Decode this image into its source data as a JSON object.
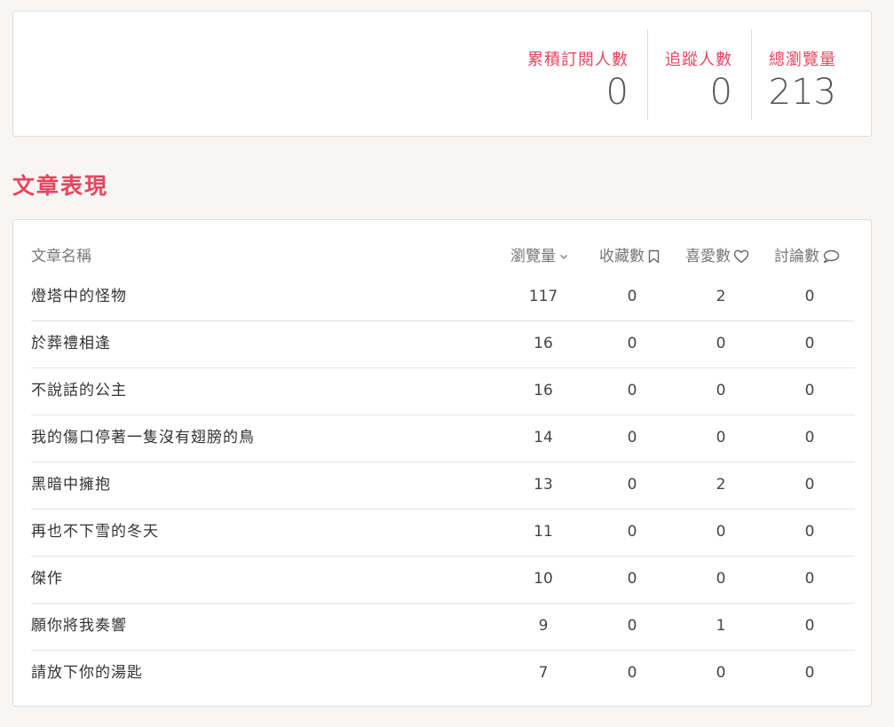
{
  "stats": {
    "subscribers": {
      "label": "累積訂閱人數",
      "value": "0"
    },
    "followers": {
      "label": "追蹤人數",
      "value": "0"
    },
    "total_views": {
      "label": "總瀏覽量",
      "value": "213"
    }
  },
  "section_title": "文章表現",
  "table": {
    "headers": {
      "name": "文章名稱",
      "views": "瀏覽量",
      "saves": "收藏數",
      "likes": "喜愛數",
      "comments": "討論數"
    },
    "icons": {
      "views": "chevron-down-icon",
      "saves": "bookmark-icon",
      "likes": "heart-icon",
      "comments": "comment-icon"
    },
    "rows": [
      {
        "name": "燈塔中的怪物",
        "views": "117",
        "saves": "0",
        "likes": "2",
        "comments": "0"
      },
      {
        "name": "於葬禮相逢",
        "views": "16",
        "saves": "0",
        "likes": "0",
        "comments": "0"
      },
      {
        "name": "不說話的公主",
        "views": "16",
        "saves": "0",
        "likes": "0",
        "comments": "0"
      },
      {
        "name": "我的傷口停著一隻沒有翅膀的鳥",
        "views": "14",
        "saves": "0",
        "likes": "0",
        "comments": "0"
      },
      {
        "name": "黑暗中擁抱",
        "views": "13",
        "saves": "0",
        "likes": "2",
        "comments": "0"
      },
      {
        "name": "再也不下雪的冬天",
        "views": "11",
        "saves": "0",
        "likes": "0",
        "comments": "0"
      },
      {
        "name": "傑作",
        "views": "10",
        "saves": "0",
        "likes": "0",
        "comments": "0"
      },
      {
        "name": "願你將我奏響",
        "views": "9",
        "saves": "0",
        "likes": "1",
        "comments": "0"
      },
      {
        "name": "請放下你的湯匙",
        "views": "7",
        "saves": "0",
        "likes": "0",
        "comments": "0"
      }
    ]
  },
  "colors": {
    "accent": "#e8455f",
    "background": "#f7f6f4",
    "card": "#ffffff"
  }
}
